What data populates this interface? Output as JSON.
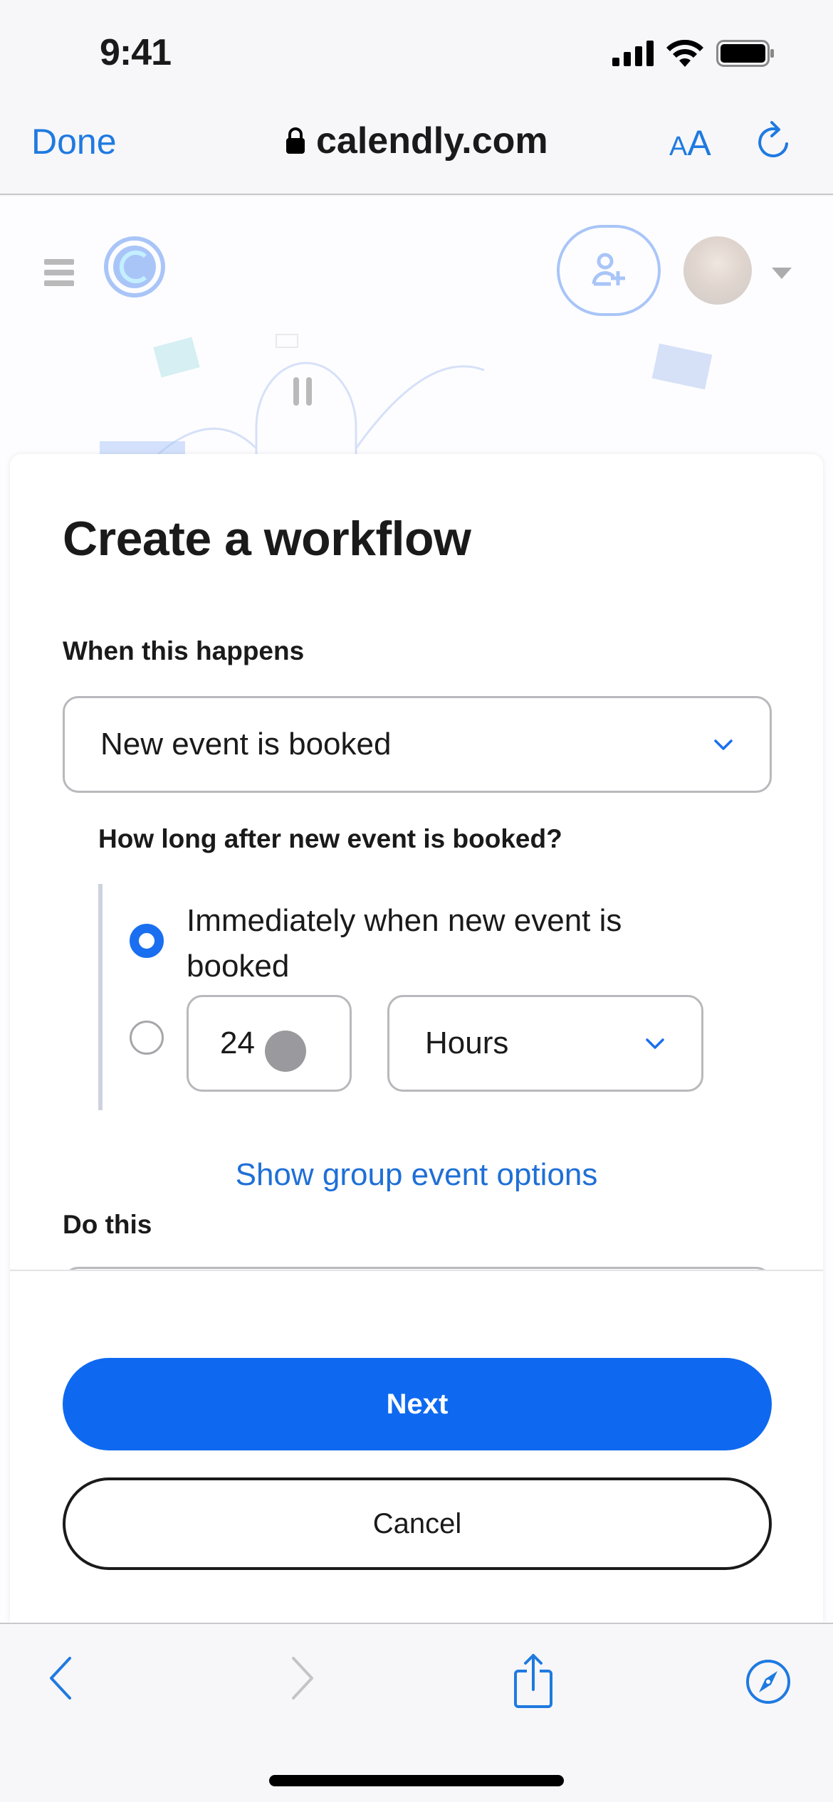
{
  "status_bar": {
    "time": "9:41",
    "icons": [
      "cellular-signal-icon",
      "wifi-icon",
      "battery-icon"
    ]
  },
  "browser": {
    "done_label": "Done",
    "url": "calendly.com",
    "text_size_label_small": "A",
    "text_size_label_large": "A",
    "icons": [
      "lock-icon",
      "reload-icon"
    ],
    "toolbar": {
      "back": "back-icon",
      "forward": "forward-icon",
      "share": "share-icon",
      "open_in_safari": "compass-icon"
    },
    "colors": {
      "accent": "#1f7ae0",
      "disabled": "#c4c4c8"
    }
  },
  "app_header": {
    "icons": [
      "hamburger-menu-icon",
      "calendly-logo-icon",
      "invite-user-icon",
      "avatar",
      "caret-down-icon"
    ]
  },
  "modal": {
    "title": "Create a workflow",
    "trigger": {
      "label": "When this happens",
      "selected": "New event is booked"
    },
    "timing": {
      "label": "How long after new event is booked?",
      "options": [
        {
          "label": "Immediately when new event is booked",
          "selected": true
        },
        {
          "label": "",
          "selected": false
        }
      ],
      "amount_value": "24",
      "unit_selected": "Hours"
    },
    "group_link": "Show group event options",
    "action": {
      "label": "Do this"
    },
    "buttons": {
      "next": "Next",
      "cancel": "Cancel"
    },
    "colors": {
      "primary": "#0e69f0",
      "link": "#1f6fd6"
    }
  }
}
